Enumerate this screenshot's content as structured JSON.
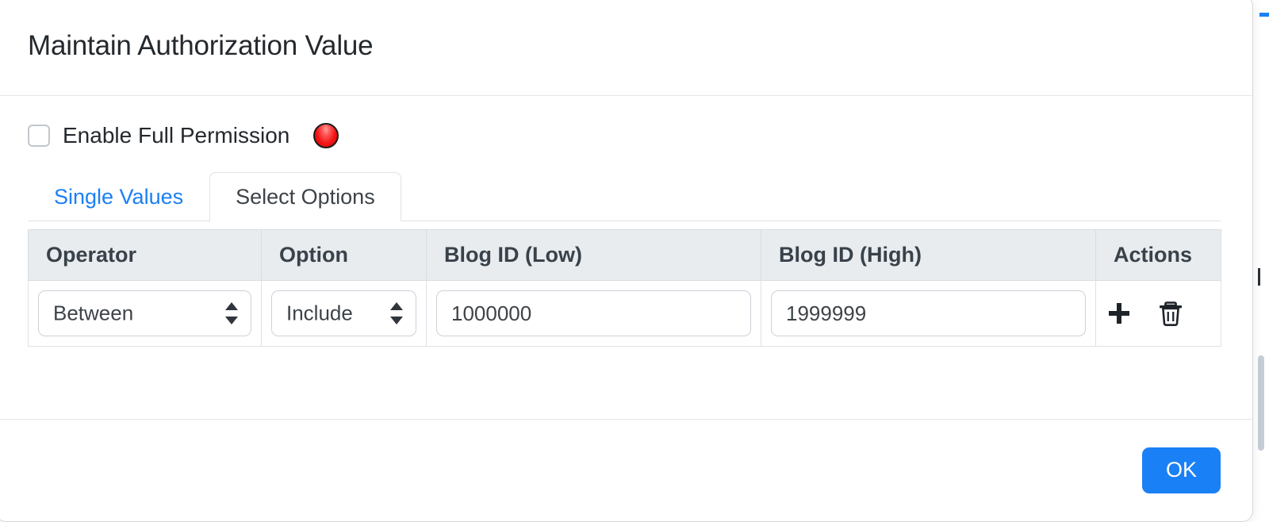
{
  "dialog": {
    "title": "Maintain Authorization Value"
  },
  "permission": {
    "checkbox_label": "Enable Full Permission",
    "checked": false,
    "status_icon": "red-led-icon",
    "status_color": "#f31616"
  },
  "tabs": [
    {
      "label": "Single Values",
      "active": false
    },
    {
      "label": "Select Options",
      "active": true
    }
  ],
  "table": {
    "columns": [
      "Operator",
      "Option",
      "Blog ID (Low)",
      "Blog ID (High)",
      "Actions"
    ],
    "rows": [
      {
        "operator": "Between",
        "option": "Include",
        "blog_id_low": "1000000",
        "blog_id_high": "1999999",
        "add_icon": "plus-icon",
        "delete_icon": "trash-icon"
      }
    ]
  },
  "footer": {
    "ok_label": "OK"
  },
  "theme": {
    "accent": "#1a80f5",
    "header_bg": "#e8ecef",
    "text": "#24292e"
  }
}
